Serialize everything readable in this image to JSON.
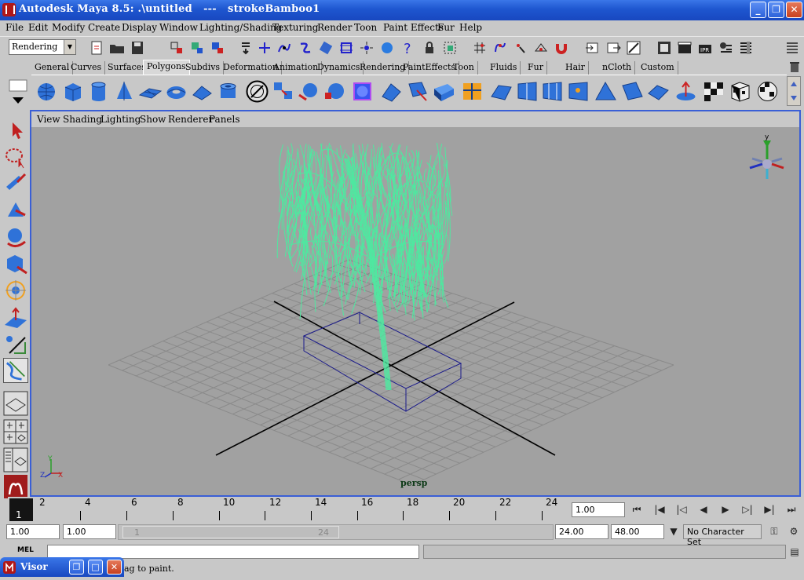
{
  "window": {
    "title": "Autodesk Maya 8.5: .\\untitled   ---   strokeBamboo1",
    "minimize": "_",
    "maximize": "❐",
    "close": "✕"
  },
  "menubar": [
    "File",
    "Edit",
    "Modify",
    "Create",
    "Display",
    "Window",
    "Lighting/Shading",
    "Texturing",
    "Render",
    "Toon",
    "Paint Effects",
    "Fur",
    "Help"
  ],
  "status_line": {
    "mode": "Rendering"
  },
  "shelf": {
    "tabs": [
      "General",
      "Curves",
      "Surfaces",
      "Polygons",
      "Subdivs",
      "Deformation",
      "Animation",
      "Dynamics",
      "Rendering",
      "PaintEffects",
      "Toon",
      "Fluids",
      "Fur",
      "Hair",
      "nCloth",
      "Custom"
    ],
    "active_tab": "Polygons"
  },
  "panel": {
    "menus": [
      "View",
      "Shading",
      "Lighting",
      "Show",
      "Renderer",
      "Panels"
    ],
    "camera": "persp",
    "axis_labels": {
      "x": "X",
      "y": "Y",
      "z": "Z"
    },
    "view_cube_y": "y"
  },
  "time_slider": {
    "ticks": [
      "2",
      "4",
      "6",
      "8",
      "10",
      "12",
      "14",
      "16",
      "18",
      "20",
      "22",
      "24"
    ],
    "current_frame": "1",
    "current_time": "1.00"
  },
  "range_slider": {
    "start_time": "1.00",
    "playback_start": "1.00",
    "thumb_start": "1",
    "thumb_end": "24",
    "playback_end": "24.00",
    "end_time": "48.00",
    "character_set": "No Character Set"
  },
  "command_line": {
    "label": "MEL"
  },
  "help_line": "ag to paint.",
  "visor": {
    "title": "Visor"
  },
  "colors": {
    "titlebar": "#1e56cf",
    "viewport_bg": "#a1a1a1",
    "bamboo_stroke": "#4fe8a0",
    "bbox": "#1a1a8a",
    "panel_border": "#3a5fd6"
  }
}
